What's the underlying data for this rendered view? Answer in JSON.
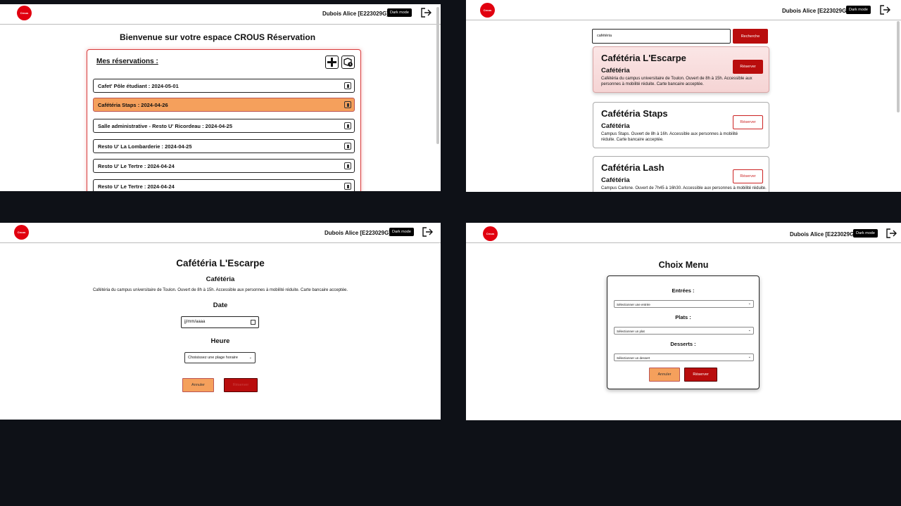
{
  "user": "Dubois Alice [E223029G]",
  "dark_mode_label": "Dark mode",
  "logo_text": "Crous",
  "panel1": {
    "title": "Bienvenue sur votre espace CROUS Réservation",
    "section_title": "Mes réservations :",
    "reservations": [
      "Cafet' Pôle étudiant : 2024-05-01",
      "Cafétéria Staps : 2024-04-26",
      "Salle administrative - Resto U' Ricordeau : 2024-04-25",
      "Resto U' La Lombarderie : 2024-04-25",
      "Resto U' Le Tertre : 2024-04-24",
      "Resto U' Le Tertre : 2024-04-24"
    ]
  },
  "panel2": {
    "search_value": "cafétéria",
    "search_button": "Recherche",
    "reserve_label": "Réserver",
    "cards": [
      {
        "name": "Cafétéria L'Escarpe",
        "type": "Cafétéria",
        "desc": "Cafétéria du campus universitaire de Toulon. Ouvert de 8h à 15h. Accessible aux personnes à mobilité réduite. Carte bancaire acceptée."
      },
      {
        "name": "Cafétéria Staps",
        "type": "Cafétéria",
        "desc": "Campus Staps. Ouvert de 8h à 16h. Accessible aux personnes à mobilité réduite. Carte bancaire acceptée."
      },
      {
        "name": "Cafétéria Lash",
        "type": "Cafétéria",
        "desc": "Campus Carlone. Ouvert de 7h45 à 16h30. Accessible aux personnes à mobilité réduite."
      }
    ]
  },
  "panel3": {
    "title": "Cafétéria L'Escarpe",
    "subtitle": "Cafétéria",
    "desc": "Cafétéria du campus universitaire de Toulon. Ouvert de 8h à 15h. Accessible aux personnes à mobilité réduite. Carte bancaire acceptée.",
    "date_label": "Date",
    "date_placeholder": "jj/mm/aaaa",
    "time_label": "Heure",
    "time_select": "Choisissez une plage horaire",
    "cancel": "Annuler",
    "reserve": "Réserver"
  },
  "panel4": {
    "title": "Choix Menu",
    "entrees_label": "Entrées :",
    "entrees_select": "Sélectionner une entrée",
    "plats_label": "Plats :",
    "plats_select": "Sélectionner un plat",
    "desserts_label": "Desserts :",
    "desserts_select": "Sélectionner un dessert",
    "cancel": "Annuler",
    "reserve": "Réserver"
  }
}
